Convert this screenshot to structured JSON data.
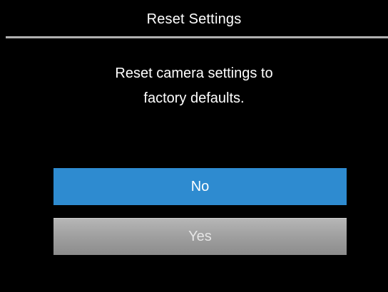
{
  "dialog": {
    "title": "Reset Settings",
    "message_line1": "Reset camera settings to",
    "message_line2": "factory defaults.",
    "options": {
      "no_label": "No",
      "yes_label": "Yes",
      "selected": "No"
    }
  },
  "colors": {
    "background": "#000000",
    "selected_option": "#2e8bd0",
    "unselected_option": "#a6a6a6",
    "text": "#ffffff"
  }
}
